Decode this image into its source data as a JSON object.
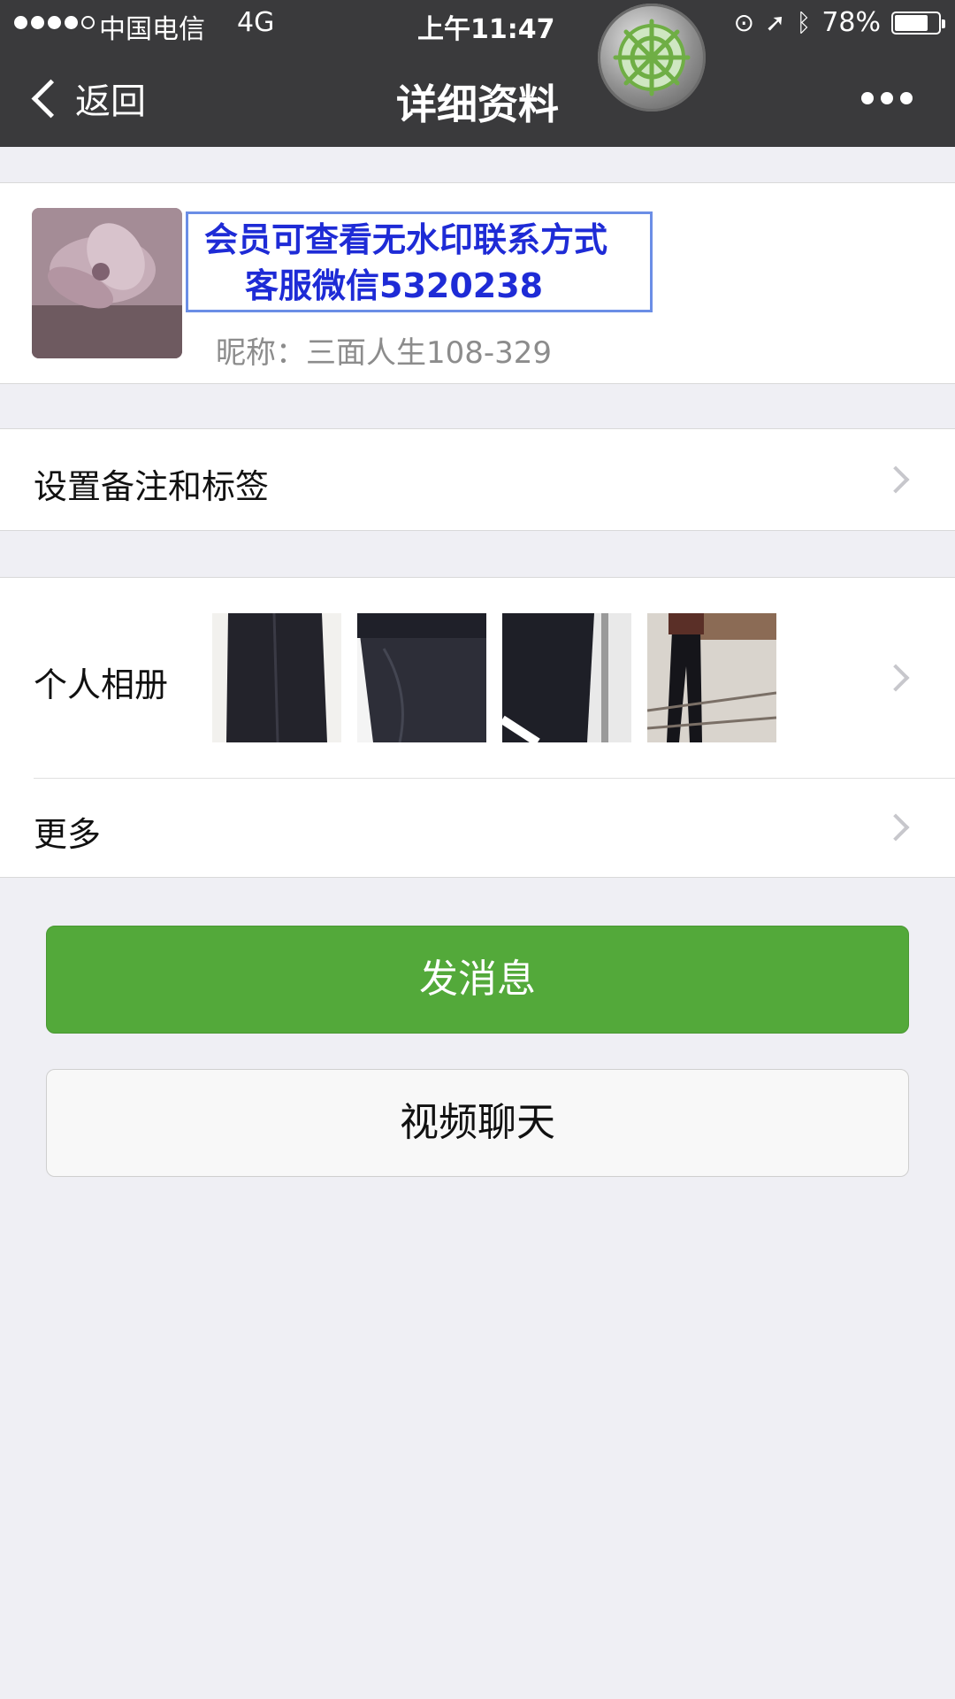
{
  "status_bar": {
    "carrier": "中国电信",
    "network": "4G",
    "time": "上午11:47",
    "battery": "78%",
    "battery_level": 0.78,
    "icons": [
      "orientation-lock-icon",
      "location-arrow-icon",
      "bluetooth-icon",
      "battery-icon"
    ]
  },
  "nav": {
    "back_label": "返回",
    "title": "详细资料",
    "more_icon": "more-dots-icon",
    "overlay_icon": "ship-wheel-icon"
  },
  "profile": {
    "watermark_line1": "会员可查看无水印联系方式",
    "watermark_line2": "客服微信5320238",
    "nickname": "昵称：三面人生108-329"
  },
  "rows": {
    "remark_label": "设置备注和标签",
    "album_label": "个人相册",
    "more_label": "更多"
  },
  "buttons": {
    "send_message": "发消息",
    "video_chat": "视频聊天"
  },
  "colors": {
    "nav_bg": "#3a3a3c",
    "primary_green": "#53a93a",
    "watermark_blue": "#1e2bd6",
    "page_bg": "#efeff4"
  }
}
